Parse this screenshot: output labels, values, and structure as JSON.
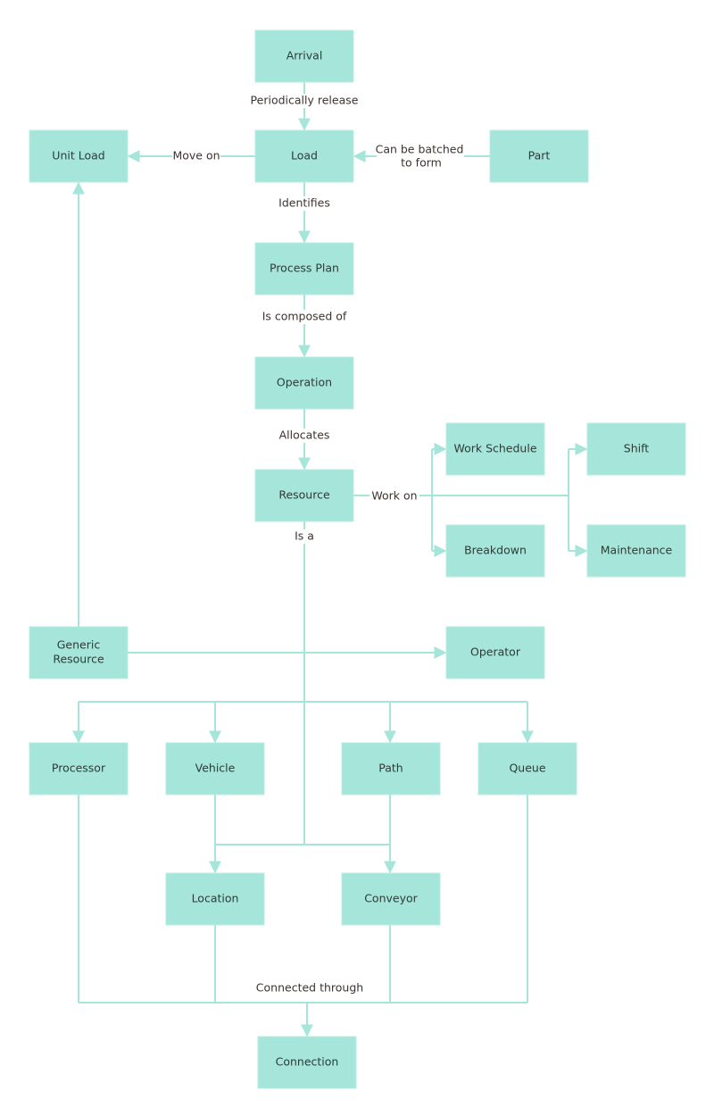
{
  "colors": {
    "node_fill": "#a6e6da",
    "edge": "#a6e6da",
    "text": "#2d3b38"
  },
  "nodes": {
    "arrival": "Arrival",
    "load": "Load",
    "unit_load": "Unit Load",
    "part": "Part",
    "process_plan": "Process Plan",
    "operation": "Operation",
    "resource": "Resource",
    "work_schedule": "Work Schedule",
    "shift": "Shift",
    "breakdown": "Breakdown",
    "maintenance": "Maintenance",
    "generic_resource": [
      "Generic",
      "Resource"
    ],
    "operator": "Operator",
    "processor": "Processor",
    "vehicle": "Vehicle",
    "path": "Path",
    "queue": "Queue",
    "location": "Location",
    "conveyor": "Conveyor",
    "connection": "Connection"
  },
  "edges": {
    "periodically_release": "Periodically release",
    "move_on": "Move on",
    "can_be_batched": [
      "Can be batched",
      "to form"
    ],
    "identifies": "Identifies",
    "is_composed_of": "Is composed of",
    "allocates": "Allocates",
    "work_on": "Work on",
    "is_a": "Is a",
    "connected_through": "Connected through"
  }
}
